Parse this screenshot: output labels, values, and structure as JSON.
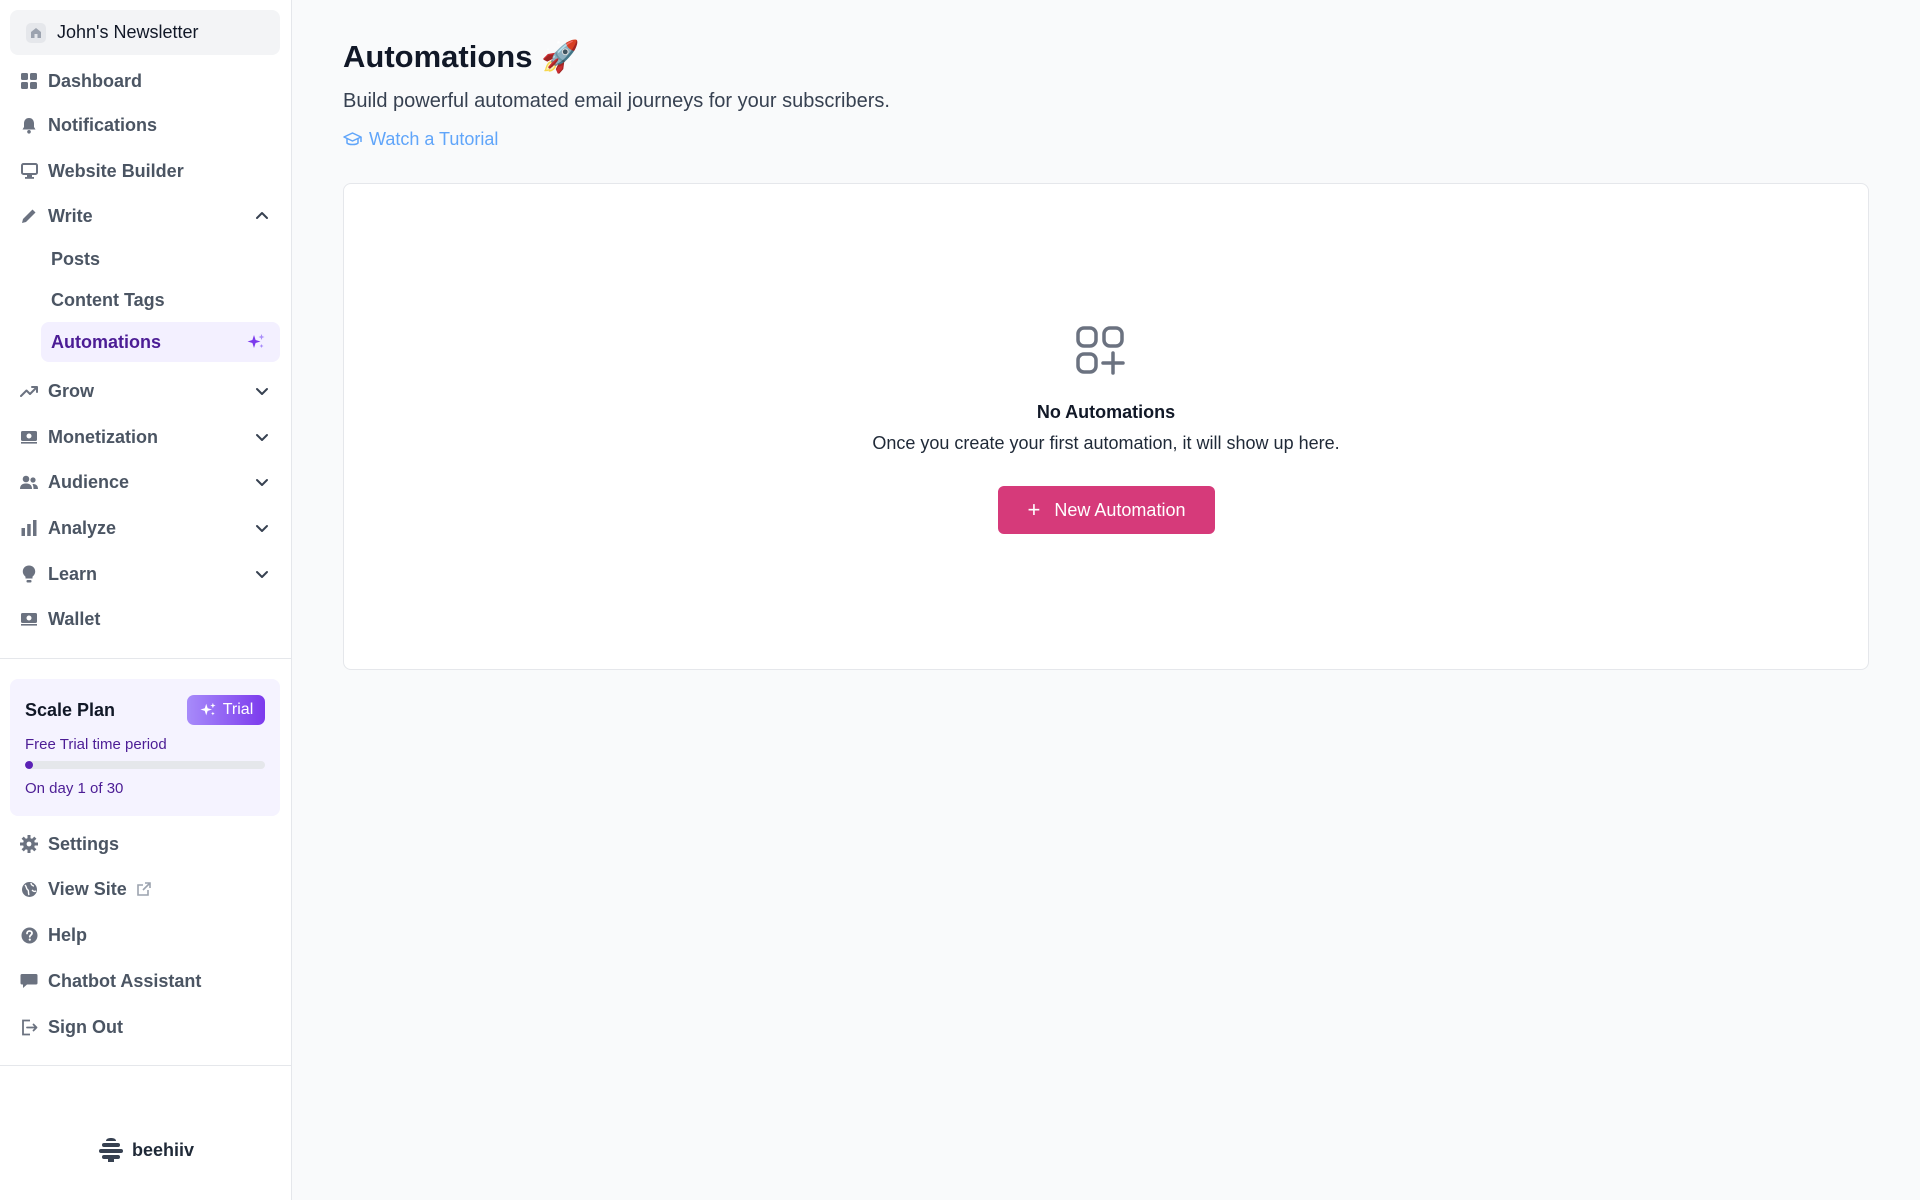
{
  "sidebar": {
    "publication_name": "John's Newsletter",
    "items": {
      "dashboard": "Dashboard",
      "notifications": "Notifications",
      "website_builder": "Website Builder",
      "write": "Write",
      "grow": "Grow",
      "monetization": "Monetization",
      "audience": "Audience",
      "analyze": "Analyze",
      "learn": "Learn",
      "wallet": "Wallet"
    },
    "write_sub": {
      "posts": "Posts",
      "content_tags": "Content Tags",
      "automations": "Automations"
    },
    "active_item": "Automations",
    "plan": {
      "name": "Scale Plan",
      "badge": "Trial",
      "subtitle": "Free Trial time period",
      "progress": 0.033,
      "day_text": "On day 1 of 30"
    },
    "bottom": {
      "settings": "Settings",
      "view_site": "View Site",
      "help": "Help",
      "chatbot": "Chatbot Assistant",
      "sign_out": "Sign Out"
    },
    "brand": "beehiiv"
  },
  "main": {
    "title": "Automations",
    "title_emoji": "🚀",
    "subtitle": "Build powerful automated email journeys for your subscribers.",
    "tutorial_link": "Watch a Tutorial",
    "empty_state": {
      "title": "No Automations",
      "description": "Once you create your first automation, it will show up here.",
      "button_label": "New Automation",
      "button_icon": "+"
    }
  },
  "colors": {
    "accent": "#d63a7a",
    "active_bg": "#f3f0ff",
    "active_text": "#4c1d95",
    "link": "#60a5fa",
    "plan_bg": "#f5f3ff"
  }
}
